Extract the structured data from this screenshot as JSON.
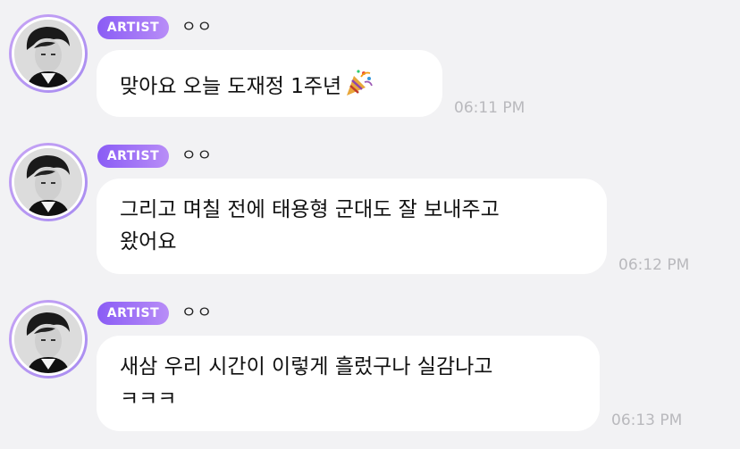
{
  "colors": {
    "background": "#f2f2f4",
    "badge_start": "#8a5cf5",
    "badge_end": "#b88df7",
    "bubble": "#ffffff",
    "timestamp": "#b9b9bd"
  },
  "messages": [
    {
      "badge": "ARTIST",
      "name": "ㅇㅇ",
      "text": "맞아요 오늘 도재정 1주년",
      "emoji": "party-popper-icon",
      "time": "06:11 PM"
    },
    {
      "badge": "ARTIST",
      "name": "ㅇㅇ",
      "text": "그리고 며칠 전에 태용형 군대도 잘 보내주고\n왔어요",
      "time": "06:12 PM"
    },
    {
      "badge": "ARTIST",
      "name": "ㅇㅇ",
      "text": "새삼 우리 시간이 이렇게 흘렀구나 실감나고\nㅋㅋㅋ",
      "time": "06:13 PM"
    }
  ]
}
